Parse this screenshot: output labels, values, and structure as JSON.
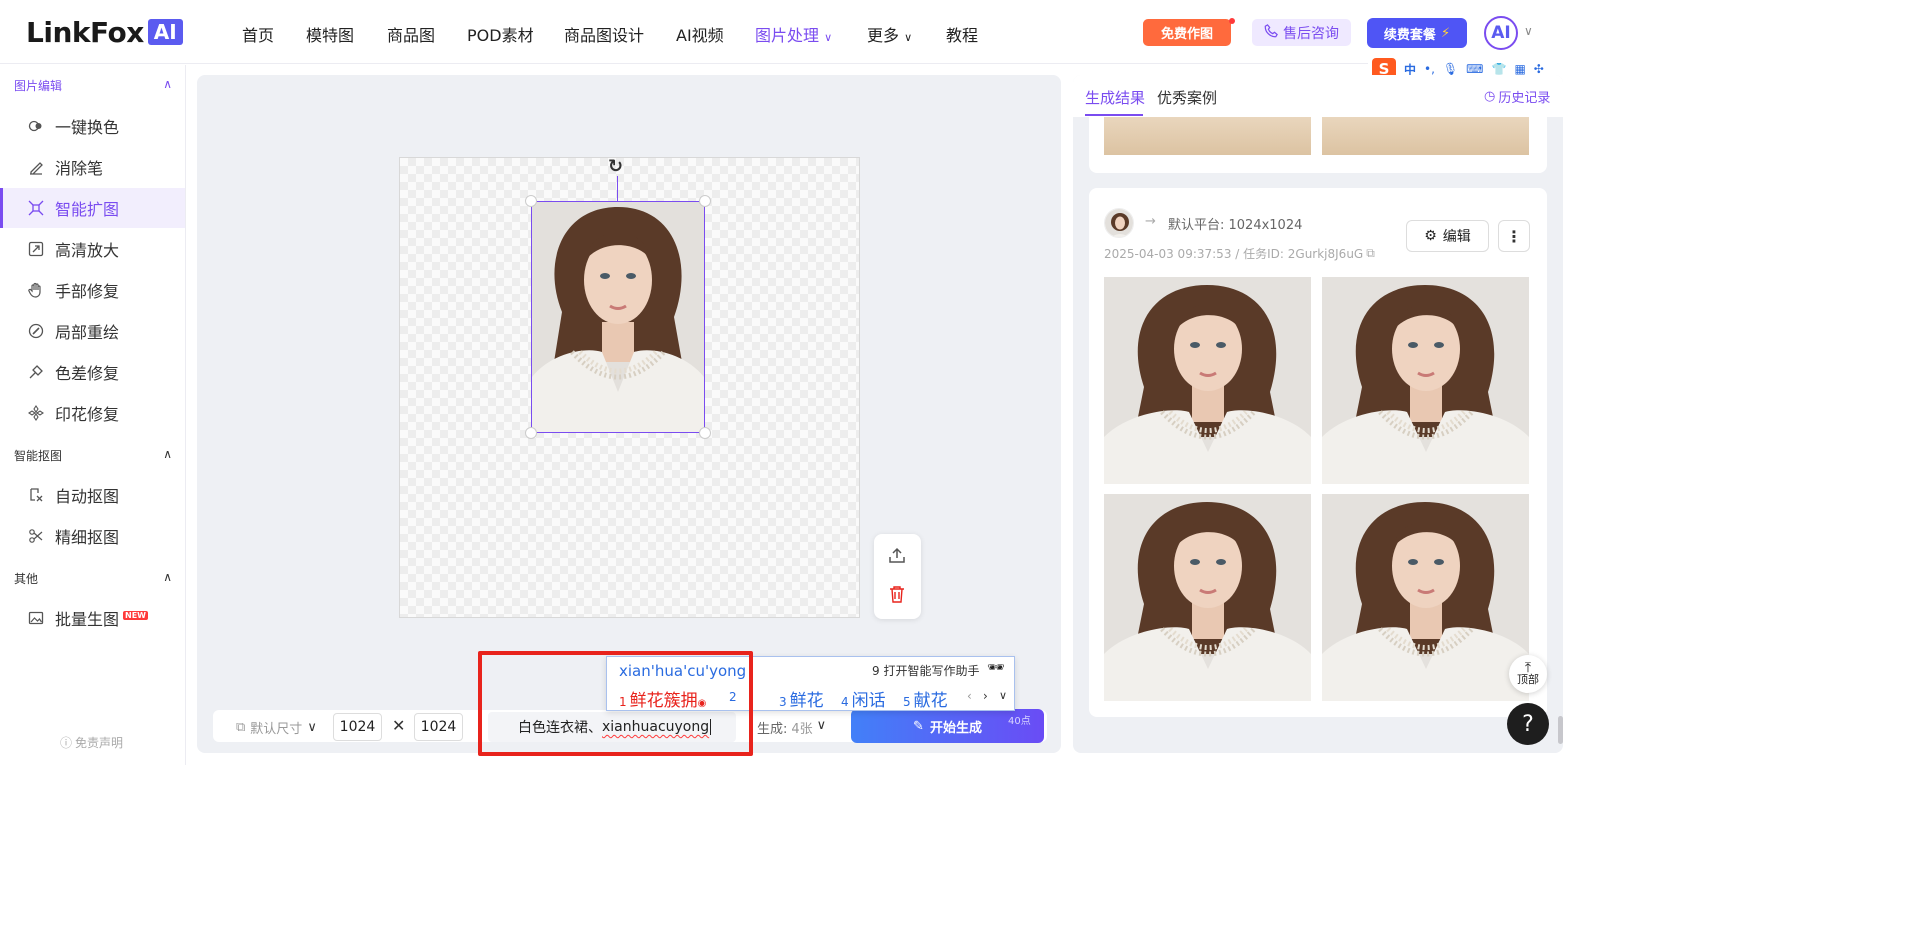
{
  "logo": {
    "word": "LinkFox",
    "badge": "AI"
  },
  "nav": [
    {
      "label": "首页"
    },
    {
      "label": "模特图"
    },
    {
      "label": "商品图"
    },
    {
      "label": "POD素材"
    },
    {
      "label": "商品图设计"
    },
    {
      "label": "AI视频"
    },
    {
      "label": "图片处理",
      "active": true,
      "has_dropdown": true
    },
    {
      "label": "更多",
      "has_dropdown": true
    },
    {
      "label": "教程"
    }
  ],
  "header": {
    "free_btn": "免费作图",
    "consult_btn": "售后咨询",
    "renew_btn": "续费套餐",
    "avatar_text": "AI"
  },
  "ime_toolbar": {
    "s": "S",
    "lang": "中",
    "punct": "•,"
  },
  "sidebar": {
    "sections": [
      {
        "title": "图片编辑",
        "items": [
          {
            "label": "一键换色",
            "icon": "color-swap-icon"
          },
          {
            "label": "消除笔",
            "icon": "eraser-pen-icon"
          },
          {
            "label": "智能扩图",
            "icon": "expand-icon",
            "active": true
          },
          {
            "label": "高清放大",
            "icon": "upscale-icon"
          },
          {
            "label": "手部修复",
            "icon": "hand-icon"
          },
          {
            "label": "局部重绘",
            "icon": "brush-icon"
          },
          {
            "label": "色差修复",
            "icon": "color-fix-icon"
          },
          {
            "label": "印花修复",
            "icon": "print-fix-icon"
          }
        ]
      },
      {
        "title": "智能抠图",
        "items": [
          {
            "label": "自动抠图",
            "icon": "auto-cutout-icon"
          },
          {
            "label": "精细抠图",
            "icon": "fine-cutout-icon"
          }
        ]
      },
      {
        "title": "其他",
        "items": [
          {
            "label": "批量生图",
            "icon": "batch-image-icon",
            "badge": "NEW"
          }
        ]
      }
    ],
    "disclaimer": "免责声明"
  },
  "editor": {
    "size_select": "默认尺寸",
    "width": "1024",
    "height": "1024",
    "times": "✕",
    "prompt_prefix": "白色连衣裙、",
    "prompt_typing": "xianhuacuyong",
    "gen_label": "生成:",
    "gen_count": "4张",
    "start_btn": "开始生成",
    "points": "40点"
  },
  "ime_candidates": {
    "pinyin": "xian'hua'cu'yong",
    "assistant": "9 打开智能写作助手",
    "items": [
      {
        "n": "1",
        "text": "鲜花簇拥"
      },
      {
        "n": "2",
        "text": ""
      },
      {
        "n": "3",
        "text": "鲜花"
      },
      {
        "n": "4",
        "text": "闲话"
      },
      {
        "n": "5",
        "text": "献花"
      }
    ]
  },
  "right_panel": {
    "tab_results": "生成结果",
    "tab_cases": "优秀案例",
    "history": "历史记录",
    "platform": "默认平台: 1024x1024",
    "meta": "2025-04-03 09:37:53 / 任务ID: 2Gurkj8J6uG",
    "edit_btn": "编辑",
    "top_btn": "顶部",
    "help_btn": "?"
  }
}
